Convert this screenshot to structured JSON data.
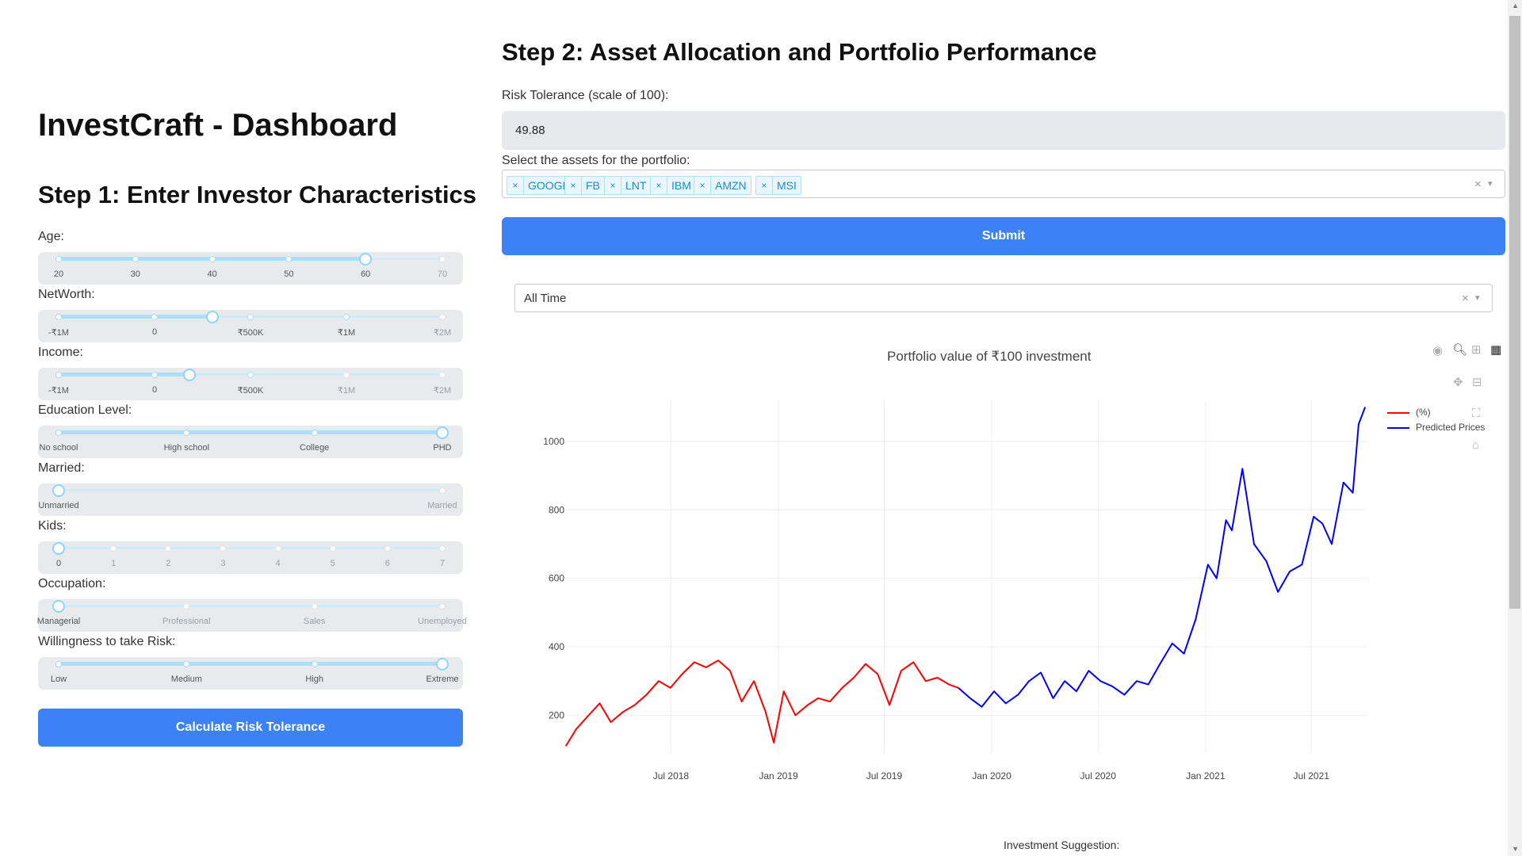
{
  "app_title": "InvestCraft - Dashboard",
  "step1_title": "Step 1: Enter Investor Characteristics",
  "sliders": [
    {
      "label": "Age:",
      "marks": [
        "20",
        "30",
        "40",
        "50",
        "60",
        "70"
      ],
      "value": 0.8,
      "active_marks": 5
    },
    {
      "label": "NetWorth:",
      "marks": [
        "-₹1M",
        "0",
        "₹500K",
        "₹1M",
        "₹2M"
      ],
      "value": 0.4,
      "active_marks": 4
    },
    {
      "label": "Income:",
      "marks": [
        "-₹1M",
        "0",
        "₹500K",
        "₹1M",
        "₹2M"
      ],
      "value": 0.34,
      "active_marks": 3
    },
    {
      "label": "Education Level:",
      "marks": [
        "No school",
        "High school",
        "College",
        "PHD"
      ],
      "value": 1.0,
      "active_marks": 4
    },
    {
      "label": "Married:",
      "marks": [
        "Unmarried",
        "Married"
      ],
      "value": 0.0,
      "active_marks": 1
    },
    {
      "label": "Kids:",
      "marks": [
        "0",
        "1",
        "2",
        "3",
        "4",
        "5",
        "6",
        "7"
      ],
      "value": 0.0,
      "active_marks": 1
    },
    {
      "label": "Occupation:",
      "marks": [
        "Managerial",
        "Professional",
        "Sales",
        "Unemployed"
      ],
      "value": 0.0,
      "active_marks": 1
    },
    {
      "label": "Willingness to take Risk:",
      "marks": [
        "Low",
        "Medium",
        "High",
        "Extreme"
      ],
      "value": 1.0,
      "active_marks": 4
    }
  ],
  "calc_button": "Calculate Risk Tolerance",
  "step2_title": "Step 2: Asset Allocation and Portfolio Performance",
  "risk_label": "Risk Tolerance (scale of 100):",
  "risk_value": "49.88",
  "assets_label": "Select the assets for the portfolio:",
  "assets": [
    "GOOGL",
    "FB",
    "LNT",
    "IBM",
    "AMZN",
    "MSI"
  ],
  "chip_remove": "×",
  "clear_symbol": "×",
  "arrow_symbol": "▾",
  "submit_button": "Submit",
  "period_value": "All Time",
  "investment_suggestion": "Investment Suggestion:",
  "colors": {
    "primary": "#3c82f6",
    "historical": "#ff0000",
    "predicted": "#0000ff"
  },
  "chart_data": {
    "type": "line",
    "title": "Portfolio value of ₹100 investment",
    "xlabel": "",
    "ylabel": "",
    "x_ticks": [
      "Jul 2018",
      "Jan 2019",
      "Jul 2019",
      "Jan 2020",
      "Jul 2020",
      "Jan 2021",
      "Jul 2021"
    ],
    "y_ticks": [
      200,
      400,
      600,
      800,
      1000
    ],
    "ylim": [
      90,
      1120
    ],
    "legend_position": "top-right",
    "series": [
      {
        "name": "(%)",
        "color": "#ff0000",
        "x": [
          "2018-01-02",
          "2018-01-20",
          "2018-02-10",
          "2018-03-01",
          "2018-03-20",
          "2018-04-10",
          "2018-04-30",
          "2018-05-20",
          "2018-06-10",
          "2018-06-30",
          "2018-07-20",
          "2018-08-10",
          "2018-08-30",
          "2018-09-20",
          "2018-10-10",
          "2018-10-30",
          "2018-11-20",
          "2018-12-10",
          "2018-12-24",
          "2019-01-10",
          "2019-01-30",
          "2019-02-20",
          "2019-03-10",
          "2019-03-30",
          "2019-04-20",
          "2019-05-10",
          "2019-05-30",
          "2019-06-20",
          "2019-07-10",
          "2019-07-30",
          "2019-08-20",
          "2019-09-10",
          "2019-09-30",
          "2019-10-20",
          "2019-11-05"
        ],
        "y": [
          110,
          160,
          200,
          235,
          180,
          210,
          230,
          260,
          300,
          280,
          320,
          355,
          340,
          360,
          330,
          240,
          300,
          210,
          120,
          270,
          200,
          230,
          250,
          240,
          280,
          310,
          350,
          320,
          230,
          330,
          355,
          300,
          310,
          290,
          280
        ]
      },
      {
        "name": "Predicted Prices",
        "color": "#0000ff",
        "x": [
          "2019-11-05",
          "2019-11-25",
          "2019-12-15",
          "2020-01-05",
          "2020-01-25",
          "2020-02-15",
          "2020-03-05",
          "2020-03-25",
          "2020-04-15",
          "2020-05-05",
          "2020-05-25",
          "2020-06-15",
          "2020-07-05",
          "2020-07-25",
          "2020-08-15",
          "2020-09-05",
          "2020-09-25",
          "2020-10-15",
          "2020-11-05",
          "2020-11-25",
          "2020-12-15",
          "2021-01-05",
          "2021-01-20",
          "2021-02-05",
          "2021-02-15",
          "2021-03-05",
          "2021-03-25",
          "2021-04-15",
          "2021-05-05",
          "2021-05-25",
          "2021-06-15",
          "2021-07-05",
          "2021-07-20",
          "2021-08-05",
          "2021-08-25",
          "2021-09-10",
          "2021-09-20",
          "2021-10-01"
        ],
        "y": [
          280,
          250,
          225,
          270,
          235,
          260,
          300,
          325,
          250,
          300,
          270,
          330,
          300,
          285,
          260,
          300,
          290,
          350,
          410,
          380,
          480,
          640,
          600,
          770,
          740,
          920,
          700,
          650,
          560,
          620,
          640,
          780,
          760,
          700,
          880,
          850,
          1050,
          1100
        ]
      }
    ]
  }
}
